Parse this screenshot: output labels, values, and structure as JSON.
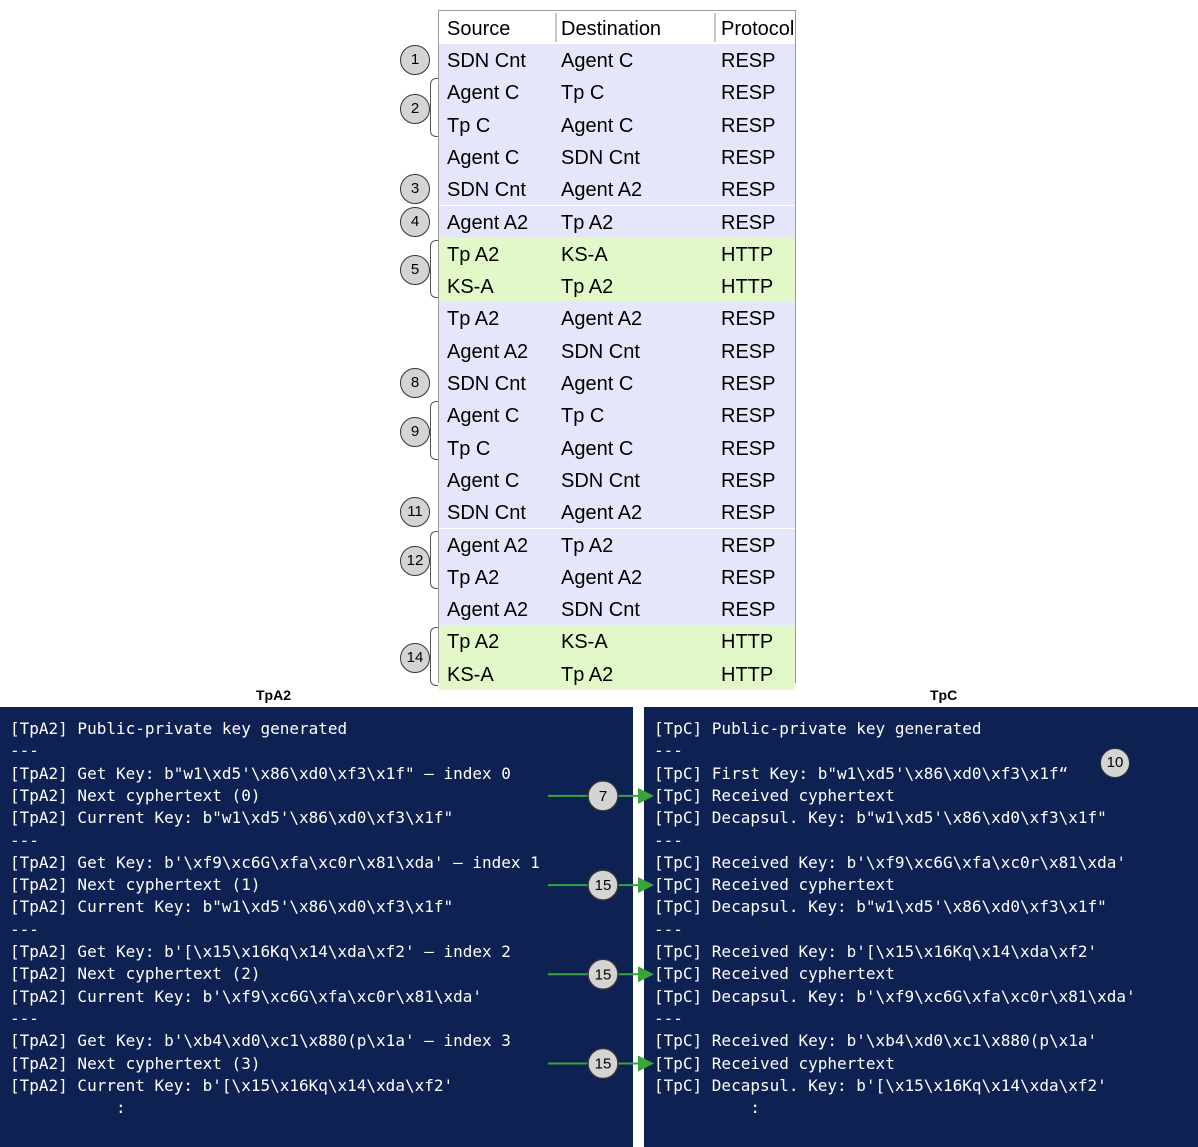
{
  "table": {
    "headers": [
      "Source",
      "Destination",
      "Protocol"
    ],
    "rows": [
      {
        "src": "SDN Cnt",
        "dst": "Agent C",
        "proto": "RESP",
        "kind": "resp"
      },
      {
        "src": "Agent C",
        "dst": "Tp C",
        "proto": "RESP",
        "kind": "resp"
      },
      {
        "src": "Tp C",
        "dst": "Agent C",
        "proto": "RESP",
        "kind": "resp"
      },
      {
        "src": "Agent C",
        "dst": "SDN Cnt",
        "proto": "RESP",
        "kind": "resp"
      },
      {
        "src": "SDN Cnt",
        "dst": "Agent A2",
        "proto": "RESP",
        "kind": "resp"
      },
      {
        "src": "Agent A2",
        "dst": "Tp A2",
        "proto": "RESP",
        "kind": "resp"
      },
      {
        "src": "Tp A2",
        "dst": "KS-A",
        "proto": "HTTP",
        "kind": "http"
      },
      {
        "src": "KS-A",
        "dst": "Tp A2",
        "proto": "HTTP",
        "kind": "http"
      },
      {
        "src": "Tp A2",
        "dst": "Agent A2",
        "proto": "RESP",
        "kind": "resp"
      },
      {
        "src": "Agent A2",
        "dst": "SDN Cnt",
        "proto": "RESP",
        "kind": "resp"
      },
      {
        "src": "SDN Cnt",
        "dst": "Agent C",
        "proto": "RESP",
        "kind": "resp"
      },
      {
        "src": "Agent C",
        "dst": "Tp C",
        "proto": "RESP",
        "kind": "resp"
      },
      {
        "src": "Tp C",
        "dst": "Agent C",
        "proto": "RESP",
        "kind": "resp"
      },
      {
        "src": "Agent C",
        "dst": "SDN Cnt",
        "proto": "RESP",
        "kind": "resp"
      },
      {
        "src": "SDN Cnt",
        "dst": "Agent A2",
        "proto": "RESP",
        "kind": "resp"
      },
      {
        "src": "Agent A2",
        "dst": "Tp A2",
        "proto": "RESP",
        "kind": "resp"
      },
      {
        "src": "Tp A2",
        "dst": "Agent A2",
        "proto": "RESP",
        "kind": "resp"
      },
      {
        "src": "Agent A2",
        "dst": "SDN Cnt",
        "proto": "RESP",
        "kind": "resp"
      },
      {
        "src": "Tp A2",
        "dst": "KS-A",
        "proto": "HTTP",
        "kind": "http"
      },
      {
        "src": "KS-A",
        "dst": "Tp A2",
        "proto": "HTTP",
        "kind": "http"
      }
    ]
  },
  "step_markers": [
    {
      "label": "1",
      "first_row": 0,
      "last_row": 0
    },
    {
      "label": "2",
      "first_row": 1,
      "last_row": 2
    },
    {
      "label": "3",
      "first_row": 4,
      "last_row": 4
    },
    {
      "label": "4",
      "first_row": 5,
      "last_row": 5
    },
    {
      "label": "5",
      "first_row": 6,
      "last_row": 7
    },
    {
      "label": "8",
      "first_row": 10,
      "last_row": 10
    },
    {
      "label": "9",
      "first_row": 11,
      "last_row": 12
    },
    {
      "label": "11",
      "first_row": 14,
      "last_row": 14
    },
    {
      "label": "12",
      "first_row": 15,
      "last_row": 16
    },
    {
      "label": "14",
      "first_row": 18,
      "last_row": 19
    }
  ],
  "consoles": {
    "tpa2": {
      "title": "TpA2",
      "lines": [
        "[TpA2] Public-private key generated",
        "---",
        "[TpA2] Get Key: b\"w1\\xd5'\\x86\\xd0\\xf3\\x1f\" – index 0",
        "[TpA2] Next cyphertext (0)",
        "[TpA2] Current Key: b\"w1\\xd5'\\x86\\xd0\\xf3\\x1f\"",
        "---",
        "[TpA2] Get Key: b'\\xf9\\xc6G\\xfa\\xc0r\\x81\\xda' – index 1",
        "[TpA2] Next cyphertext (1)",
        "[TpA2] Current Key: b\"w1\\xd5'\\x86\\xd0\\xf3\\x1f\"",
        "---",
        "[TpA2] Get Key: b'[\\x15\\x16Kq\\x14\\xda\\xf2' – index 2",
        "[TpA2] Next cyphertext (2)",
        "[TpA2] Current Key: b'\\xf9\\xc6G\\xfa\\xc0r\\x81\\xda'",
        "---",
        "[TpA2] Get Key: b'\\xb4\\xd0\\xc1\\x880(p\\x1a' – index 3",
        "[TpA2] Next cyphertext (3)",
        "[TpA2] Current Key: b'[\\x15\\x16Kq\\x14\\xda\\xf2'",
        "           :"
      ]
    },
    "tpc": {
      "title": "TpC",
      "lines": [
        "[TpC] Public-private key generated",
        "---",
        "[TpC] First Key: b\"w1\\xd5'\\x86\\xd0\\xf3\\x1f“",
        "[TpC] Received cyphertext",
        "[TpC] Decapsul. Key: b\"w1\\xd5'\\x86\\xd0\\xf3\\x1f\"",
        "---",
        "[TpC] Received Key: b'\\xf9\\xc6G\\xfa\\xc0r\\x81\\xda'",
        "[TpC] Received cyphertext",
        "[TpC] Decapsul. Key: b\"w1\\xd5'\\x86\\xd0\\xf3\\x1f\"",
        "---",
        "[TpC] Received Key: b'[\\x15\\x16Kq\\x14\\xda\\xf2'",
        "[TpC] Received cyphertext",
        "[TpC] Decapsul. Key: b'\\xf9\\xc6G\\xfa\\xc0r\\x81\\xda'",
        "---",
        "[TpC] Received Key: b'\\xb4\\xd0\\xc1\\x880(p\\x1a'",
        "[TpC] Received cyphertext",
        "[TpC] Decapsul. Key: b'[\\x15\\x16Kq\\x14\\xda\\xf2'",
        "          :"
      ]
    }
  },
  "console_marker": {
    "label": "10",
    "console": "tpc",
    "line": 2
  },
  "arrows": [
    {
      "label": "7",
      "from_line": 3,
      "to_line": 3
    },
    {
      "label": "15",
      "from_line": 7,
      "to_line": 7
    },
    {
      "label": "15",
      "from_line": 11,
      "to_line": 11
    },
    {
      "label": "15",
      "from_line": 15,
      "to_line": 15
    }
  ],
  "colors": {
    "resp_row": "#e6e6fa",
    "http_row": "#e3f8c8",
    "console_bg": "#0d2153",
    "arrow": "#3aa43a",
    "marker_fill": "#d4d4d4"
  }
}
